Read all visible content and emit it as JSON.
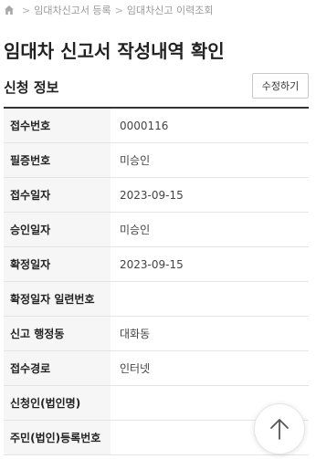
{
  "breadcrumb": {
    "home_icon": "home-icon",
    "separator": ">",
    "items": [
      "임대차신고서 등록",
      "임대차신고 이력조회"
    ]
  },
  "page": {
    "title": "임대차 신고서 작성내역 확인"
  },
  "section": {
    "title": "신청 정보",
    "edit_label": "수정하기"
  },
  "info_rows": [
    {
      "label": "접수번호",
      "value": "0000116"
    },
    {
      "label": "필증번호",
      "value": "미승인"
    },
    {
      "label": "접수일자",
      "value": "2023-09-15"
    },
    {
      "label": "승인일자",
      "value": "미승인"
    },
    {
      "label": "확정일자",
      "value": "2023-09-15"
    },
    {
      "label": "확정일자 일련번호",
      "value": ""
    },
    {
      "label": "신고 행정동",
      "value": "대화동"
    },
    {
      "label": "접수경로",
      "value": "인터넷"
    },
    {
      "label": "신청인(법인명)",
      "value": ""
    },
    {
      "label": "주민(법인)등록번호",
      "value": ""
    }
  ],
  "scroll_top": {
    "icon": "arrow-up-icon"
  }
}
